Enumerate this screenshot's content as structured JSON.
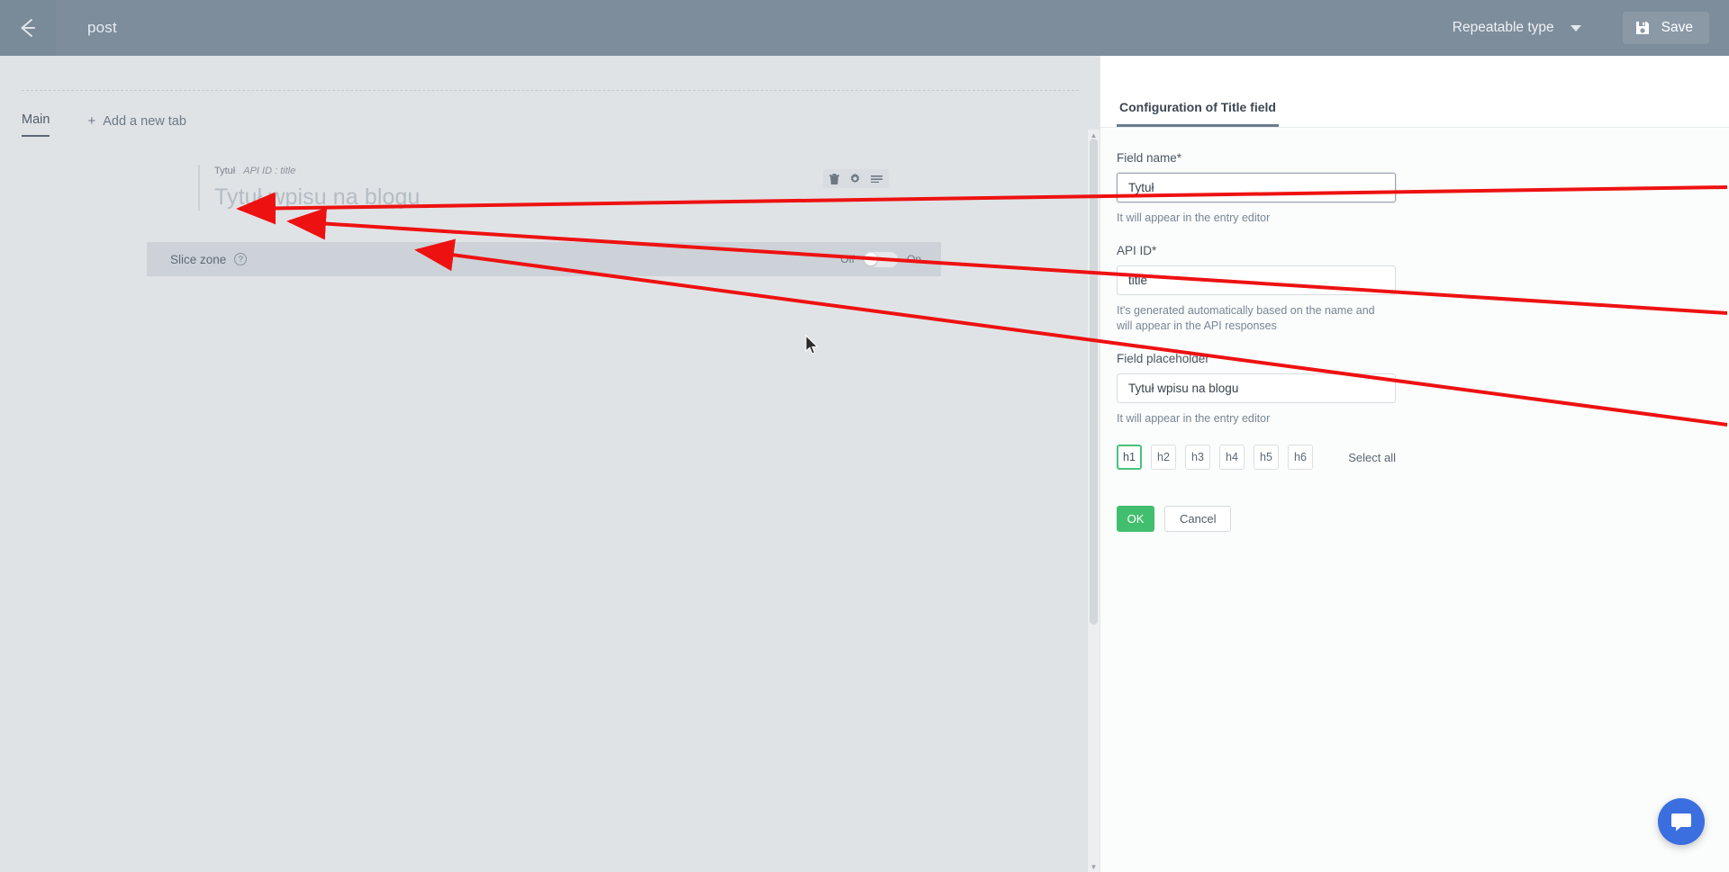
{
  "topbar": {
    "back_icon": "arrow-left-icon",
    "title": "post",
    "type_select_label": "Repeatable type",
    "save_icon": "floppy-disk-icon",
    "save_label": "Save"
  },
  "tabs": {
    "items": [
      {
        "label": "Main",
        "active": true
      },
      {
        "label": "Add a new tab",
        "plus": "+",
        "active": false
      }
    ]
  },
  "field_preview": {
    "field_name": "Tytuł",
    "api_id_text": "API ID : title",
    "placeholder_preview": "Tytuł wpisu na blogu",
    "tools": [
      "trash-icon",
      "gear-icon",
      "drag-handle-icon"
    ]
  },
  "slice_zone": {
    "label": "Slice zone",
    "help_icon": "question-mark-icon",
    "toggle_off_label": "Off",
    "toggle_on_label": "On",
    "toggle_state": "off"
  },
  "panel": {
    "tab_title": "Configuration of Title field",
    "field_name": {
      "label": "Field name*",
      "value": "Tytuł",
      "helper": "It will appear in the entry editor"
    },
    "api_id": {
      "label": "API ID*",
      "value": "title",
      "helper": "It's generated automatically based on the name and will appear in the API responses"
    },
    "placeholder": {
      "label": "Field placeholder",
      "value": "Tytuł wpisu na blogu",
      "helper": "It will appear in the entry editor"
    },
    "headings": {
      "options": [
        "h1",
        "h2",
        "h3",
        "h4",
        "h5",
        "h6"
      ],
      "selected": "h1",
      "select_all_label": "Select all"
    },
    "actions": {
      "ok_label": "OK",
      "cancel_label": "Cancel"
    }
  },
  "support": {
    "intercom_icon": "chat-bubble-icon"
  },
  "colors": {
    "topbar": "#7d8d9c",
    "accent_green": "#42bf6e",
    "tab_underline": "#6b7c8e",
    "annotation_red": "#ee1111",
    "intercom_blue": "#3b6fe0"
  }
}
